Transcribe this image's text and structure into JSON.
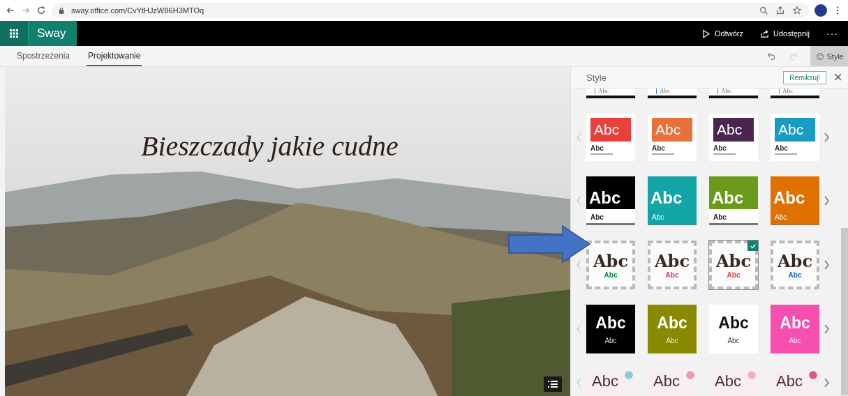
{
  "browser": {
    "url": "sway.office.com/CvYtHJzW86H3MTOq"
  },
  "app_bar": {
    "app_name": "Sway",
    "actions": [
      {
        "label": "Odtwórz",
        "kind": "play"
      },
      {
        "label": "Udostępnij",
        "kind": "share"
      }
    ],
    "more": "···"
  },
  "tabs": [
    {
      "label": "Spostrzeżenia",
      "selected": false
    },
    {
      "label": "Projektowanie",
      "selected": true
    }
  ],
  "toolbar": {
    "style_button": "Style"
  },
  "canvas": {
    "title": "Bieszczady jakie cudne"
  },
  "style_panel": {
    "title": "Style",
    "remix_button": "Remiksuj!",
    "close": "×",
    "rows": [
      {
        "kind": "strip",
        "tiles": [
          {
            "big": "Abc",
            "color": "#e8413c",
            "selected": false
          },
          {
            "big": "Abc",
            "color": "#3b7fd0",
            "selected": false
          },
          {
            "big": "Abc",
            "color": "#e8413c",
            "selected": false
          },
          {
            "big": "Abc",
            "color": "#7aa33a",
            "selected": false
          }
        ]
      },
      {
        "kind": "band",
        "tiles": [
          {
            "big": "Abc",
            "small": "Abc",
            "color": "#e8413c",
            "selected": false
          },
          {
            "big": "Abc",
            "small": "Abc",
            "color": "#e8703a",
            "selected": false
          },
          {
            "big": "Abc",
            "small": "Abc",
            "color": "#4a2550",
            "selected": false
          },
          {
            "big": "Abc",
            "small": "Abc",
            "color": "#1b9ac4",
            "selected": false
          }
        ]
      },
      {
        "kind": "block",
        "tiles": [
          {
            "kind": "split",
            "big": "Abc",
            "small": "Abc",
            "color": "#000000",
            "selected": false
          },
          {
            "kind": "full",
            "big": "Abc",
            "small": "Abc",
            "color": "#12a5a5",
            "selected": false
          },
          {
            "kind": "split",
            "big": "Abc",
            "small": "Abc",
            "color": "#6a9a1a",
            "selected": false
          },
          {
            "kind": "full",
            "big": "Abc",
            "small": "Abc",
            "color": "#e07000",
            "selected": false
          }
        ]
      },
      {
        "kind": "texture",
        "tiles": [
          {
            "big": "Abc",
            "small": "Abc",
            "color": "#16884a",
            "selected": false
          },
          {
            "big": "Abc",
            "small": "Abc",
            "color": "#e8248a",
            "selected": false
          },
          {
            "big": "Abc",
            "small": "Abc",
            "color": "#e8413c",
            "selected": true
          },
          {
            "big": "Abc",
            "small": "Abc",
            "color": "#1b6ac4",
            "selected": false
          }
        ]
      },
      {
        "kind": "solid",
        "tiles": [
          {
            "big": "Abc",
            "small": "Abc",
            "color": "#000000",
            "selected": false
          },
          {
            "big": "Abc",
            "small": "Abc",
            "color": "#8a8a00",
            "selected": false
          },
          {
            "big": "Abc",
            "small": "Abc",
            "color": "#ffffff",
            "selected": false
          },
          {
            "big": "Abc",
            "small": "Abc",
            "color": "#f74fb0",
            "selected": false
          }
        ]
      },
      {
        "kind": "floral",
        "tiles": [
          {
            "big": "Abc",
            "color": "#8cc8d8",
            "selected": false
          },
          {
            "big": "Abc",
            "color": "#e89ab0",
            "selected": false
          },
          {
            "big": "Abc",
            "color": "#f0b0c0",
            "selected": false
          },
          {
            "big": "Abc",
            "color": "#d85a8a",
            "selected": false
          }
        ]
      }
    ]
  }
}
